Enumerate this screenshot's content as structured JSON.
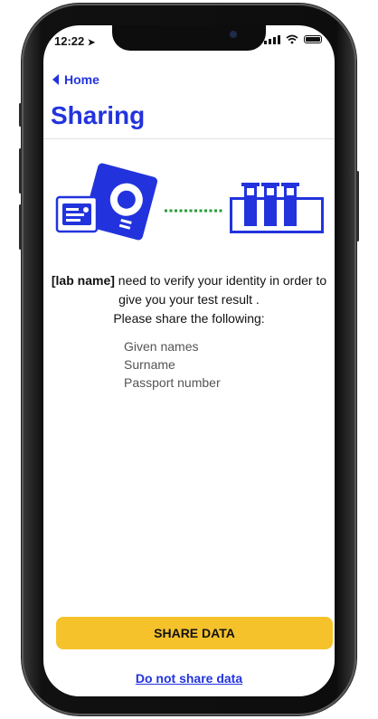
{
  "status_bar": {
    "time": "12:22"
  },
  "nav": {
    "back_label": "Home"
  },
  "header": {
    "title": "Sharing"
  },
  "message": {
    "lab_name": "[lab name]",
    "line1_rest": " need to verify your identity in order to give you your test result .",
    "line2": "Please share the following:"
  },
  "fields": [
    "Given names",
    "Surname",
    "Passport number"
  ],
  "actions": {
    "share_label": "SHARE DATA",
    "decline_label": "Do not share data"
  },
  "colors": {
    "accent": "#2233dd",
    "button": "#f5c22b",
    "connector": "#2a9a3a"
  },
  "icons": [
    "id-card-icon",
    "test-tubes-icon",
    "location-arrow-icon",
    "signal-icon",
    "wifi-icon",
    "battery-icon",
    "chevron-left-icon"
  ]
}
